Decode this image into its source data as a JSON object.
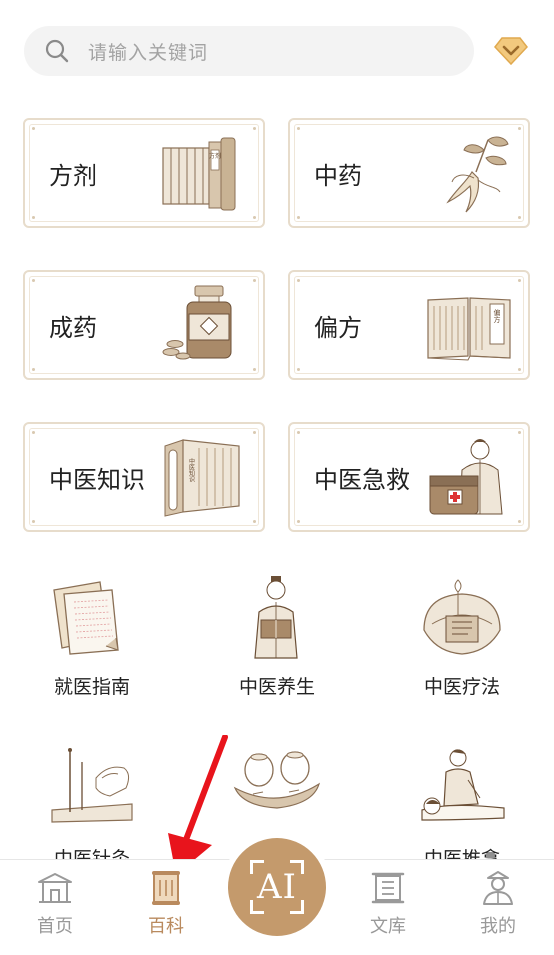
{
  "search": {
    "placeholder": "请输入关键词",
    "icon": "search-icon"
  },
  "vip": {
    "icon": "diamond-chevron-icon",
    "color": "#e7b86a"
  },
  "cards": [
    {
      "label": "方剂",
      "icon": "prescription-scroll-icon",
      "art_text": "方剂"
    },
    {
      "label": "中药",
      "icon": "ginseng-icon"
    },
    {
      "label": "成药",
      "icon": "medicine-bottle-icon"
    },
    {
      "label": "偏方",
      "icon": "open-book-icon",
      "art_text": "偏方"
    },
    {
      "label": "中医知识",
      "icon": "knowledge-scroll-icon",
      "art_text": "中医知识"
    },
    {
      "label": "中医急救",
      "icon": "first-aid-doctor-icon"
    }
  ],
  "grid": [
    {
      "label": "就医指南",
      "icon": "guide-papers-icon"
    },
    {
      "label": "中医养生",
      "icon": "scholar-reading-icon"
    },
    {
      "label": "中医疗法",
      "icon": "moxibustion-icon"
    },
    {
      "label": "中医针灸",
      "icon": "acupuncture-icon"
    },
    {
      "label": "",
      "icon": "cupping-icon"
    },
    {
      "label": "中医推拿",
      "icon": "massage-icon"
    }
  ],
  "tabs": [
    {
      "label": "首页",
      "icon": "temple-home-icon"
    },
    {
      "label": "百科",
      "icon": "scroll-encyclopedia-icon",
      "active": true
    },
    {
      "label": "AI",
      "icon": "ai-scan-icon"
    },
    {
      "label": "文库",
      "icon": "library-scroll-icon"
    },
    {
      "label": "我的",
      "icon": "user-profile-icon"
    }
  ],
  "colors": {
    "accent": "#c49a6c",
    "active_tab": "#b98a5e",
    "card_border": "#e7dccb",
    "arrow": "#e8141c"
  }
}
